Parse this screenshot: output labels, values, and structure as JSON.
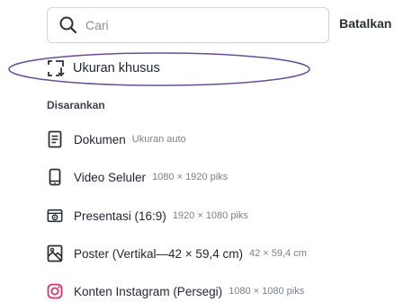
{
  "search": {
    "placeholder": "Cari",
    "value": ""
  },
  "cancel_label": "Batalkan",
  "custom_size_label": "Ukuran khusus",
  "section_title": "Disarankan",
  "items": [
    {
      "name": "Dokumen",
      "sub": "Ukuran auto",
      "icon": "document-icon"
    },
    {
      "name": "Video Seluler",
      "sub": "1080 × 1920 piks",
      "icon": "mobile-video-icon"
    },
    {
      "name": "Presentasi (16:9)",
      "sub": "1920 × 1080 piks",
      "icon": "presentation-icon"
    },
    {
      "name": "Poster (Vertikal—42 × 59,4 cm)",
      "sub": "42 × 59,4 cm",
      "icon": "poster-icon"
    },
    {
      "name": "Konten Instagram (Persegi)",
      "sub": "1080 × 1080 piks",
      "icon": "instagram-icon"
    }
  ],
  "colors": {
    "instagram": "#e1306c",
    "highlight": "#6a4c9c",
    "text": "#1f2430",
    "muted": "#7a7f89"
  }
}
